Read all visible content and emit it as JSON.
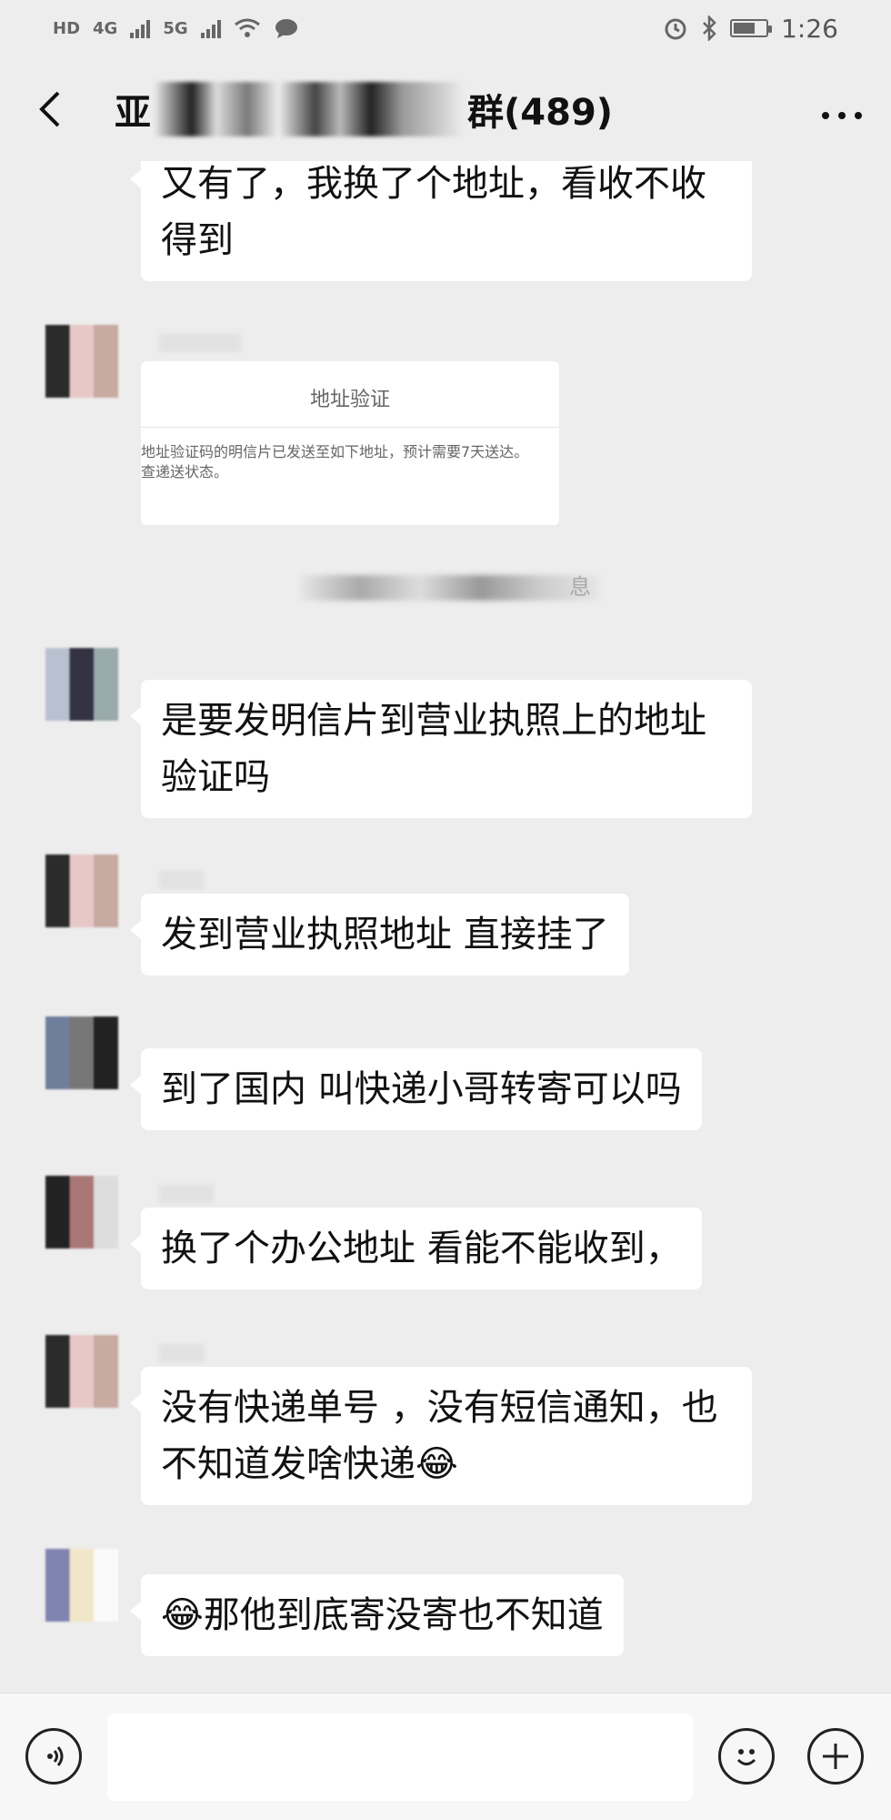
{
  "status_bar": {
    "network_left": "HD",
    "network_4g": "4G",
    "network_5g": "5G",
    "time": "1:26"
  },
  "header": {
    "title_prefix": "亚",
    "title_suffix": "群(489)",
    "back_icon": "chevron-left-icon",
    "more_icon": "ellipsis-icon"
  },
  "messages": [
    {
      "text": "又有了，我换了个地址，看收不收得到"
    },
    {
      "card_title": "地址验证",
      "card_body_line1": "地址验证码的明信片已发送至如下地址，预计需要7天送达。",
      "card_body_line2": "查递送状态。"
    },
    {
      "system_suffix": "息"
    },
    {
      "text": "是要发明信片到营业执照上的地址验证吗"
    },
    {
      "text": "发到营业执照地址 直接挂了"
    },
    {
      "text": "到了国内 叫快递小哥转寄可以吗"
    },
    {
      "text": "换了个办公地址 看能不能收到，"
    },
    {
      "text": "没有快递单号 ，没有短信通知，也不知道发啥快递😂"
    },
    {
      "text": "😂那他到底寄没寄也不知道"
    }
  ],
  "input_bar": {
    "voice_icon": "voice-icon",
    "emoji_icon": "emoji-icon",
    "plus_icon": "plus-icon"
  }
}
